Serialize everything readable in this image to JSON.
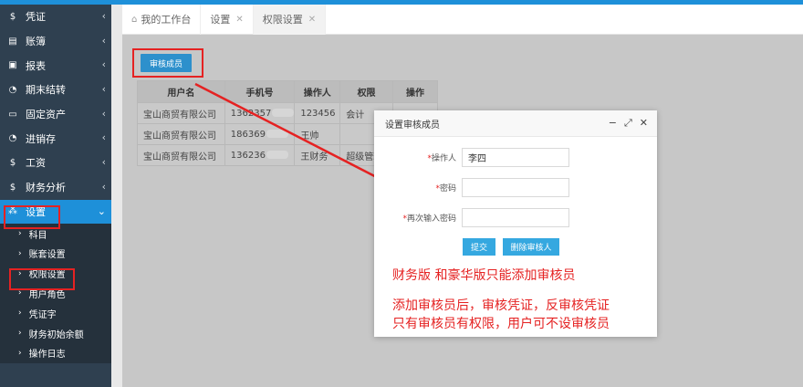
{
  "sidebar": {
    "items": [
      {
        "icon": "$",
        "label": "凭证"
      },
      {
        "icon": "▤",
        "label": "账簿"
      },
      {
        "icon": "▣",
        "label": "报表"
      },
      {
        "icon": "◔",
        "label": "期末结转"
      },
      {
        "icon": "▭",
        "label": "固定资产"
      },
      {
        "icon": "◔",
        "label": "进销存"
      },
      {
        "icon": "$",
        "label": "工资"
      },
      {
        "icon": "$",
        "label": "财务分析"
      },
      {
        "icon": "⁂",
        "label": "设置"
      }
    ],
    "sub_items": [
      "科目",
      "账套设置",
      "权限设置",
      "用户角色",
      "凭证字",
      "财务初始余额",
      "操作日志"
    ]
  },
  "tabs": [
    {
      "label": "我的工作台",
      "closable": false
    },
    {
      "label": "设置",
      "closable": true
    },
    {
      "label": "权限设置",
      "closable": true
    }
  ],
  "toolbar": {
    "audit_button": "审核成员"
  },
  "table": {
    "headers": [
      "用户名",
      "手机号",
      "操作人",
      "权限",
      "操作"
    ],
    "rows": [
      [
        "宝山商贸有限公司",
        "1362357",
        "123456",
        "会计",
        ""
      ],
      [
        "宝山商贸有限公司",
        "186369",
        "王帅",
        "",
        ""
      ],
      [
        "宝山商贸有限公司",
        "136236",
        "王财务",
        "超级管理",
        ""
      ]
    ]
  },
  "modal": {
    "title": "设置审核成员",
    "fields": [
      {
        "label": "操作人",
        "value": "李四"
      },
      {
        "label": "密码",
        "value": ""
      },
      {
        "label": "再次输入密码",
        "value": ""
      }
    ],
    "submit_label": "提交",
    "delete_label": "删除审核人"
  },
  "notes": {
    "line1": "财务版 和豪华版只能添加审核员",
    "line2": "添加审核员后，审核凭证，反审核凭证",
    "line3": "只有审核员有权限，用户可不设审核员"
  },
  "colors": {
    "accent": "#1e90d9",
    "sidebar": "#2f4050",
    "annotation": "#e52222"
  }
}
